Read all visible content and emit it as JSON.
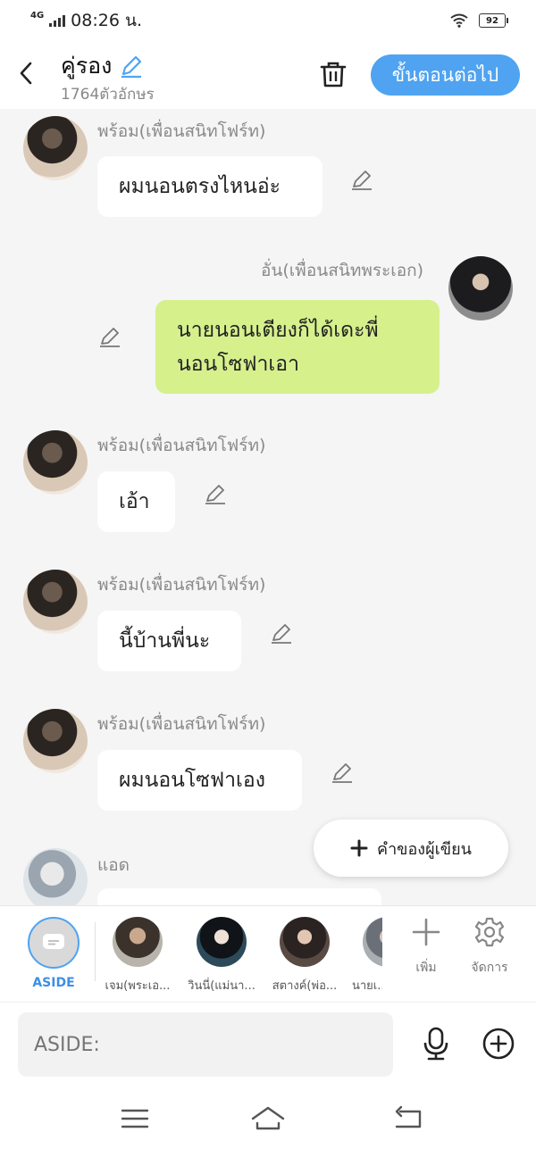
{
  "status": {
    "network": "4G",
    "time": "08:26 น.",
    "battery": "92"
  },
  "header": {
    "title": "คู่รอง",
    "subtitle": "1764ตัวอักษร",
    "next_label": "ขั้นตอนต่อไป"
  },
  "messages": [
    {
      "name": "พร้อม(เพื่อนสนิทโฟร์ท)",
      "text": "ผมนอนตรงไหนอ่ะ"
    },
    {
      "name": "อั่น(เพื่อนสนิทพระเอก)",
      "text": "นายนอนเตียงก็ได้เดะพี่นอนโซฟาเอา"
    },
    {
      "name": "พร้อม(เพื่อนสนิทโฟร์ท)",
      "text": "เอ้า"
    },
    {
      "name": "พร้อม(เพื่อนสนิทโฟร์ท)",
      "text": "นี้บ้านพี่นะ"
    },
    {
      "name": "พร้อม(เพื่อนสนิทโฟร์ท)",
      "text": "ผมนอนโซฟาเอง"
    },
    {
      "name": "แอด",
      "text": ""
    }
  ],
  "fab": {
    "label": "คำของผู้เขียน"
  },
  "characters": {
    "aside_label": "ASIDE",
    "items": [
      {
        "label": "เจม(พระเอ..."
      },
      {
        "label": "วินนี่(แม่นา..."
      },
      {
        "label": "สตางค์(พ่อ..."
      },
      {
        "label": "นายเ..."
      }
    ],
    "add_label": "เพิ่ม",
    "manage_label": "จัดการ"
  },
  "composer": {
    "placeholder": "ASIDE:"
  },
  "colors": {
    "accent": "#4fa3f0",
    "mine_bubble": "#d6f08c"
  }
}
